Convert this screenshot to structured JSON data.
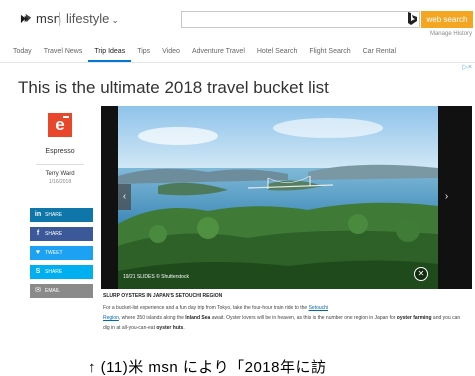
{
  "header": {
    "logo_text": "msn",
    "section_label": "lifestyle",
    "search_button": "web search",
    "manage_history": "Manage History"
  },
  "nav": {
    "items": [
      "Today",
      "Travel News",
      "Trip Ideas",
      "Tips",
      "Video",
      "Adventure Travel",
      "Hotel Search",
      "Flight Search",
      "Car Rental"
    ],
    "active_index": 2
  },
  "ad_marker": "▷×",
  "article": {
    "title": "This is the ultimate 2018 travel bucket list",
    "source": "Espresso",
    "author": "Terry Ward",
    "date": "1/16/2018"
  },
  "share_buttons": [
    {
      "label": "SHARE",
      "icon": "linkedin-icon",
      "glyph": "in",
      "color": "#0e76a8"
    },
    {
      "label": "SHARE",
      "icon": "facebook-icon",
      "glyph": "f",
      "color": "#3b5998"
    },
    {
      "label": "TWEET",
      "icon": "twitter-icon",
      "glyph": "♥",
      "color": "#1da1f2"
    },
    {
      "label": "SHARE",
      "icon": "skype-icon",
      "glyph": "S",
      "color": "#00aff0"
    },
    {
      "label": "EMAIL",
      "icon": "mail-icon",
      "glyph": "✉",
      "color": "#8a8a8a"
    }
  ],
  "slideshow": {
    "counter": "19/21 SLIDES © Shutterstock",
    "prev_icon": "chevron-left-icon",
    "next_icon": "chevron-right-icon",
    "close_icon": "close-icon"
  },
  "caption": {
    "title": "SLURP OYSTERS IN JAPAN'S SETOUCHI REGION",
    "p1": "For a bucket-list experience and a fun day trip from Tokyo, take the four-hour train ride to the ",
    "link1": "Setouchi",
    "link2": "Region",
    "p2": ", where 350 islands along the ",
    "bold1": "Inland Sea",
    "p3": " await. Oyster lovers will be in heaven, as this is the number one region in Japan for ",
    "bold2": "oyster farming",
    "p4": " and you can dig in at all-you-can-eat ",
    "bold3": "oyster huts",
    "p5": "."
  },
  "bottom_caption": "↑ (11)米 msn により「2018年に訪",
  "colors": {
    "accent": "#0078d4",
    "search_button": "#f4a623",
    "espresso": "#e8472b"
  }
}
